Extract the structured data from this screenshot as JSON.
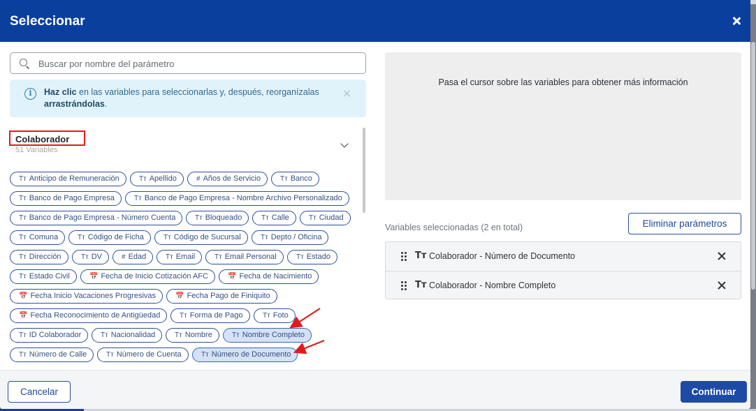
{
  "modal": {
    "title": "Seleccionar"
  },
  "search": {
    "placeholder": "Buscar por nombre del parámetro"
  },
  "info": {
    "bold_start": "Haz clic",
    "text_middle": " en las variables para seleccionarlas y, después, reorganízalas ",
    "bold_end": "arrastrándolas",
    "text_end": "."
  },
  "group": {
    "title": "Colaborador",
    "count": "51 Variables"
  },
  "chips": [
    {
      "icon": "Tт",
      "label": "Anticipo de Remuneración",
      "selected": false
    },
    {
      "icon": "Tт",
      "label": "Apellido",
      "selected": false
    },
    {
      "icon": "#",
      "label": "Años de Servicio",
      "selected": false
    },
    {
      "icon": "Tт",
      "label": "Banco",
      "selected": false
    },
    {
      "icon": "Tт",
      "label": "Banco de Pago Empresa",
      "selected": false
    },
    {
      "icon": "Tт",
      "label": "Banco de Pago Empresa - Nombre Archivo Personalizado",
      "selected": false
    },
    {
      "icon": "Tт",
      "label": "Banco de Pago Empresa - Número Cuenta",
      "selected": false
    },
    {
      "icon": "Tт",
      "label": "Bloqueado",
      "selected": false
    },
    {
      "icon": "Tт",
      "label": "Calle",
      "selected": false
    },
    {
      "icon": "Tт",
      "label": "Ciudad",
      "selected": false
    },
    {
      "icon": "Tт",
      "label": "Comuna",
      "selected": false
    },
    {
      "icon": "Tт",
      "label": "Código de Ficha",
      "selected": false
    },
    {
      "icon": "Tт",
      "label": "Código de Sucursal",
      "selected": false
    },
    {
      "icon": "Tт",
      "label": "Depto / Oficina",
      "selected": false
    },
    {
      "icon": "Tт",
      "label": "Dirección",
      "selected": false
    },
    {
      "icon": "Tт",
      "label": "DV",
      "selected": false
    },
    {
      "icon": "#",
      "label": "Edad",
      "selected": false
    },
    {
      "icon": "Tт",
      "label": "Email",
      "selected": false
    },
    {
      "icon": "Tт",
      "label": "Email Personal",
      "selected": false
    },
    {
      "icon": "Tт",
      "label": "Estado",
      "selected": false
    },
    {
      "icon": "Tт",
      "label": "Estado Civil",
      "selected": false
    },
    {
      "icon": "📅",
      "label": "Fecha de Inicio Cotización AFC",
      "selected": false
    },
    {
      "icon": "📅",
      "label": "Fecha de Nacimiento",
      "selected": false
    },
    {
      "icon": "📅",
      "label": "Fecha Inicio Vacaciones Progresivas",
      "selected": false
    },
    {
      "icon": "📅",
      "label": "Fecha Pago de Finiquito",
      "selected": false
    },
    {
      "icon": "📅",
      "label": "Fecha Reconocimiento de Antigüedad",
      "selected": false
    },
    {
      "icon": "Tт",
      "label": "Forma de Pago",
      "selected": false
    },
    {
      "icon": "Tт",
      "label": "Foto",
      "selected": false
    },
    {
      "icon": "Tт",
      "label": "ID Colaborador",
      "selected": false
    },
    {
      "icon": "Tт",
      "label": "Nacionalidad",
      "selected": false
    },
    {
      "icon": "Tт",
      "label": "Nombre",
      "selected": false
    },
    {
      "icon": "Tт",
      "label": "Nombre Completo",
      "selected": true
    },
    {
      "icon": "Tт",
      "label": "Número de Calle",
      "selected": false
    },
    {
      "icon": "Tт",
      "label": "Número de Cuenta",
      "selected": false
    },
    {
      "icon": "Tт",
      "label": "Número de Documento",
      "selected": true
    }
  ],
  "preview": {
    "text": "Pasa el cursor sobre las variables para obtener más información"
  },
  "selected": {
    "count_text": "Variables seleccionadas (2 en total)",
    "remove_label": "Eliminar parámetros",
    "items": [
      {
        "icon": "Tт",
        "label": "Colaborador - Número de Documento"
      },
      {
        "icon": "Tт",
        "label": "Colaborador - Nombre Completo"
      }
    ]
  },
  "footer": {
    "cancel_label": "Cancelar",
    "continue_label": "Continuar"
  },
  "colors": {
    "header": "#0b3f9e",
    "accent": "#1e4aa5",
    "annotation_red": "#e11b1b"
  }
}
